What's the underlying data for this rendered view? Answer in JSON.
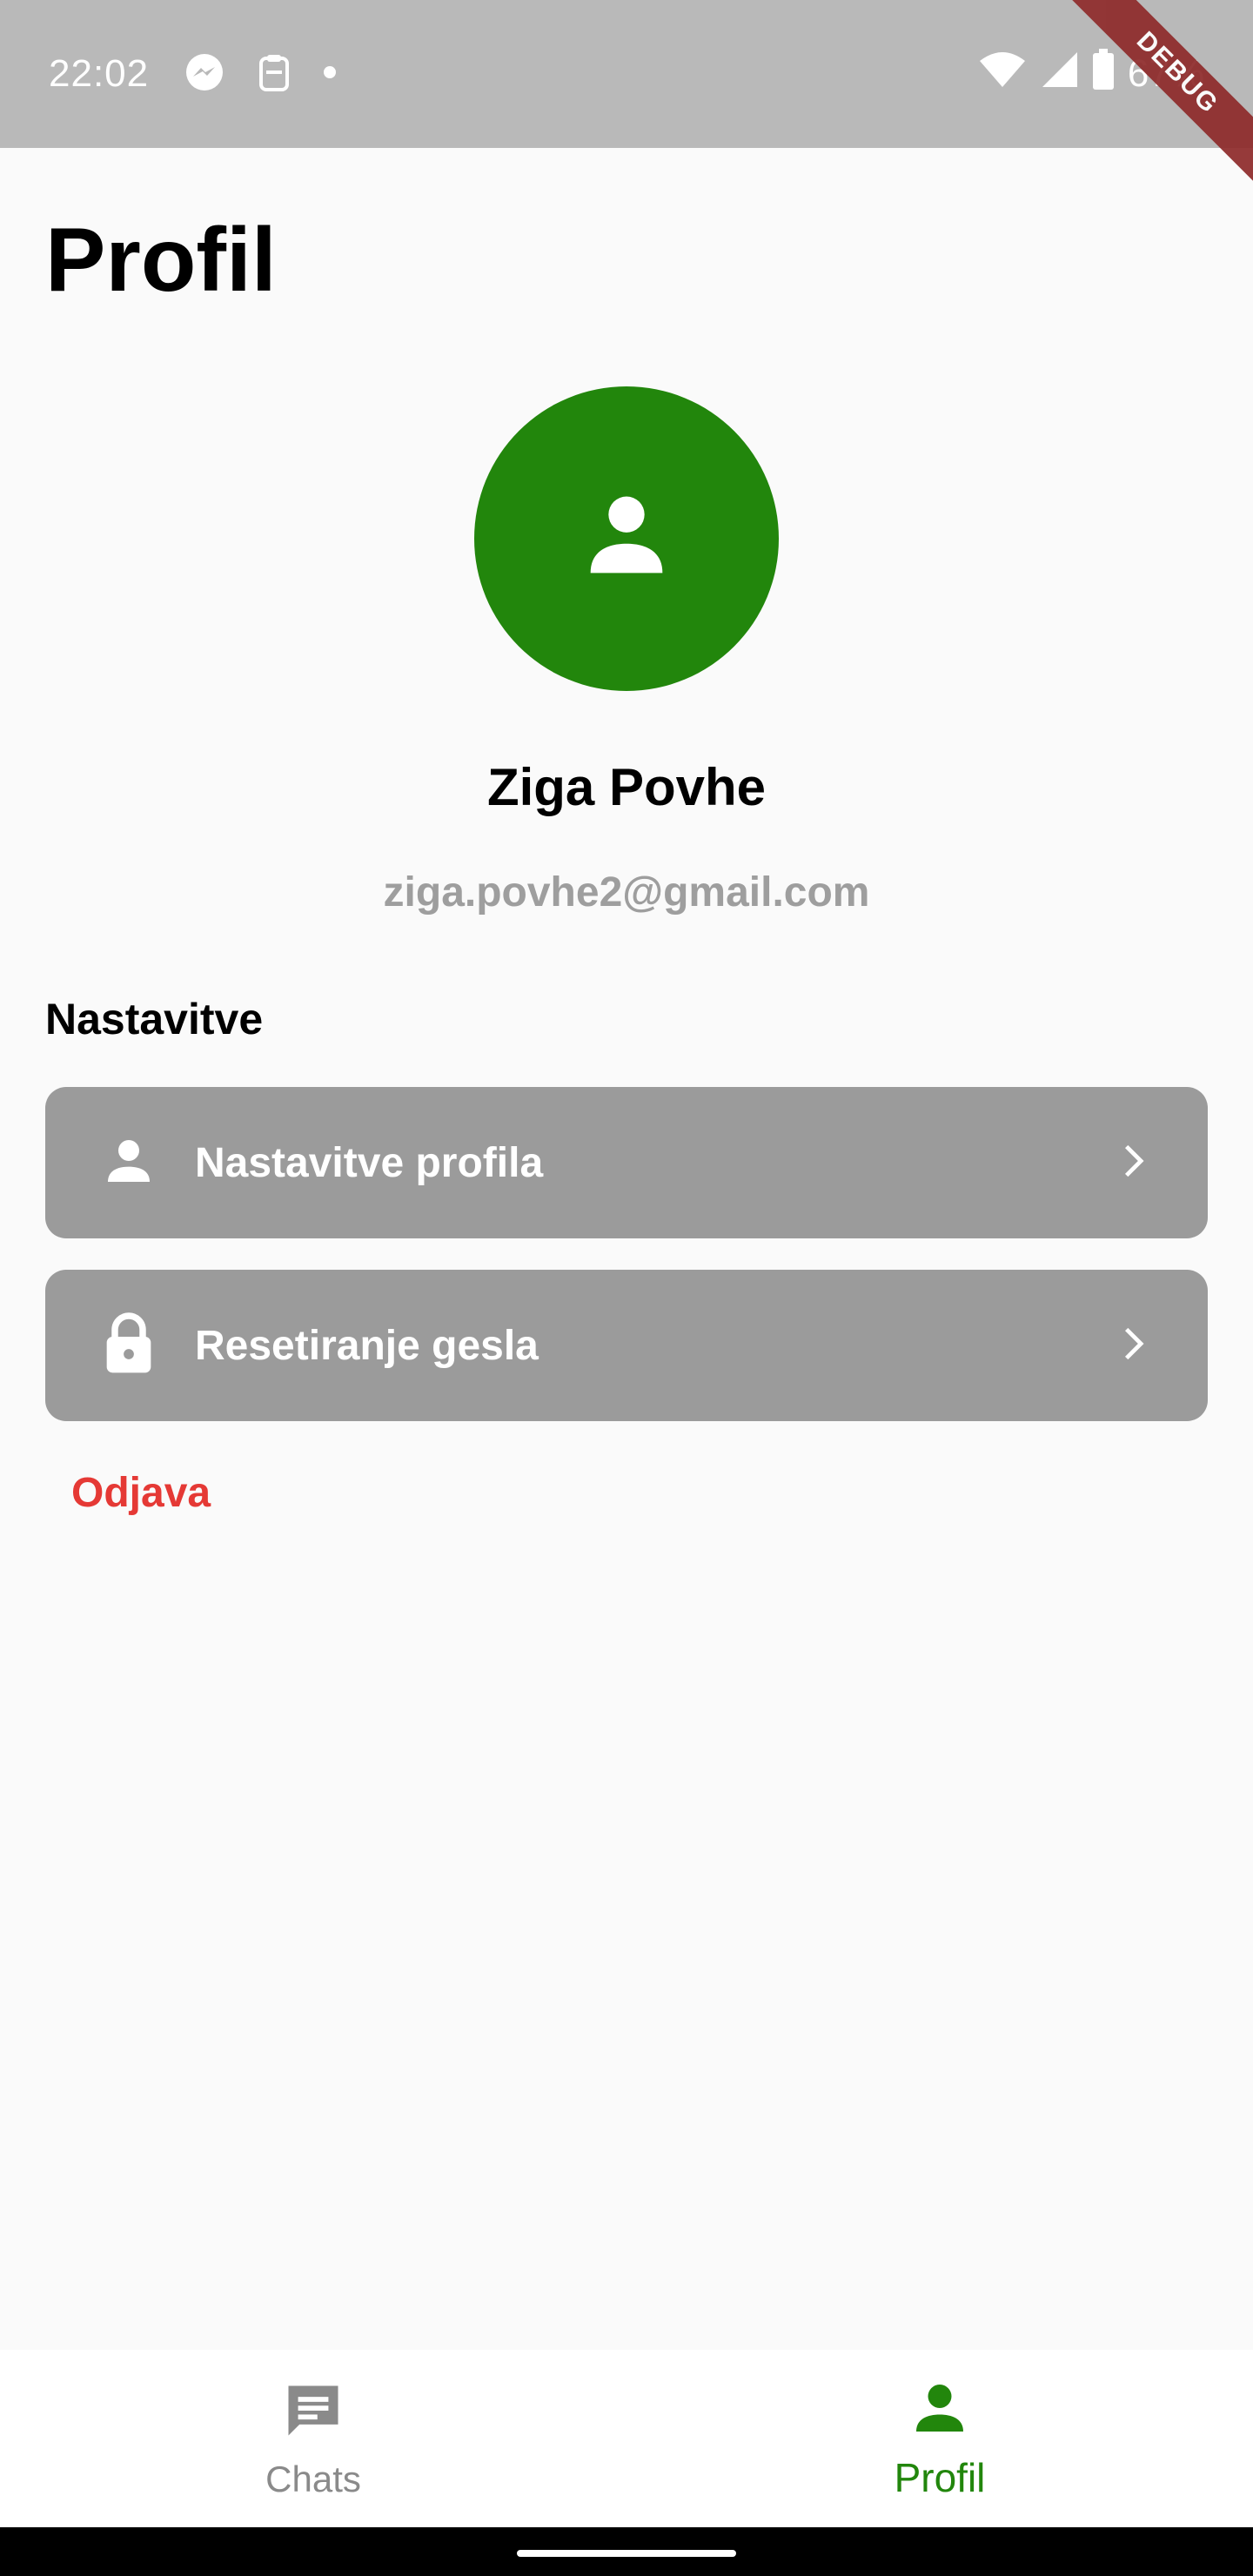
{
  "status_bar": {
    "time": "22:02",
    "battery": "67%",
    "icons": [
      "messenger-icon",
      "clipboard-icon",
      "dot-icon",
      "wifi-icon",
      "signal-icon",
      "battery-icon"
    ]
  },
  "debug_banner": "DEBUG",
  "page": {
    "title": "Profil"
  },
  "profile": {
    "name": "Ziga Povhe",
    "email": "ziga.povhe2@gmail.com",
    "avatar_color": "#22860c"
  },
  "settings": {
    "section_title": "Nastavitve",
    "items": [
      {
        "label": "Nastavitve profila",
        "icon": "person-icon"
      },
      {
        "label": "Resetiranje gesla",
        "icon": "lock-icon"
      }
    ],
    "item_background": "#9b9b9b"
  },
  "logout": {
    "label": "Odjava",
    "color": "#e53935"
  },
  "bottom_nav": {
    "items": [
      {
        "label": "Chats",
        "icon": "chat-icon",
        "active": false
      },
      {
        "label": "Profil",
        "icon": "person-icon",
        "active": true
      }
    ],
    "active_color": "#22860c",
    "inactive_color": "#8a8a8a"
  }
}
